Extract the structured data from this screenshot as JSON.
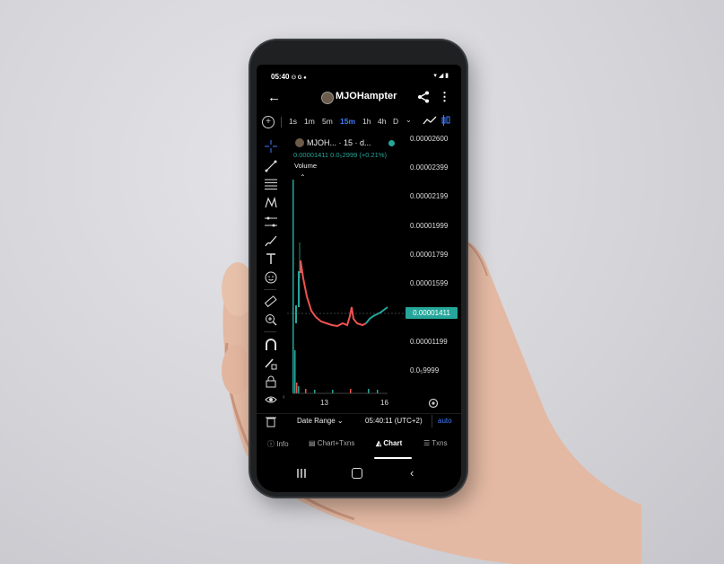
{
  "status_bar": {
    "time": "05:40",
    "indicators": "⚇ G ●",
    "right_icons": "▾ ◢ ▮"
  },
  "header": {
    "title": "MJOHampter",
    "back_icon": "back-arrow-icon",
    "share_icon": "share-icon",
    "more_icon": "more-vertical-icon"
  },
  "timeframes": {
    "items": [
      "1s",
      "1m",
      "5m",
      "15m",
      "1h",
      "4h",
      "D"
    ],
    "active": "15m",
    "dropdown": "⌄"
  },
  "chart": {
    "symbol": "MJOH...",
    "interval": "· 15 · d...",
    "price_line": "0.00001411  0.0₅2999 (+0.21%)",
    "volume_label": "Volume",
    "collapse": "⌃",
    "current_price": "0.00001411",
    "price_axis": [
      "0.00002600",
      "0.00002399",
      "0.00002199",
      "0.00001999",
      "0.00001799",
      "0.00001599",
      "0.00001199",
      "0.0₅9999"
    ],
    "x_axis": [
      "13",
      "16"
    ],
    "colors": {
      "up": "#26a69a",
      "down": "#ef5350",
      "accent": "#3f7cff"
    }
  },
  "bottom_bar": {
    "date_range": "Date Range ⌄",
    "clock": "05:40:11 (UTC+2)",
    "auto": "auto"
  },
  "tabs": [
    {
      "label": "Info",
      "icon": "info-icon"
    },
    {
      "label": "Chart+Txns",
      "icon": "table-icon"
    },
    {
      "label": "Chart",
      "icon": "chart-area-icon"
    },
    {
      "label": "Txns",
      "icon": "list-icon"
    }
  ],
  "active_tab": "Chart",
  "nav": {
    "recent": "recent-apps-icon",
    "home": "home-icon",
    "back": "‹"
  }
}
